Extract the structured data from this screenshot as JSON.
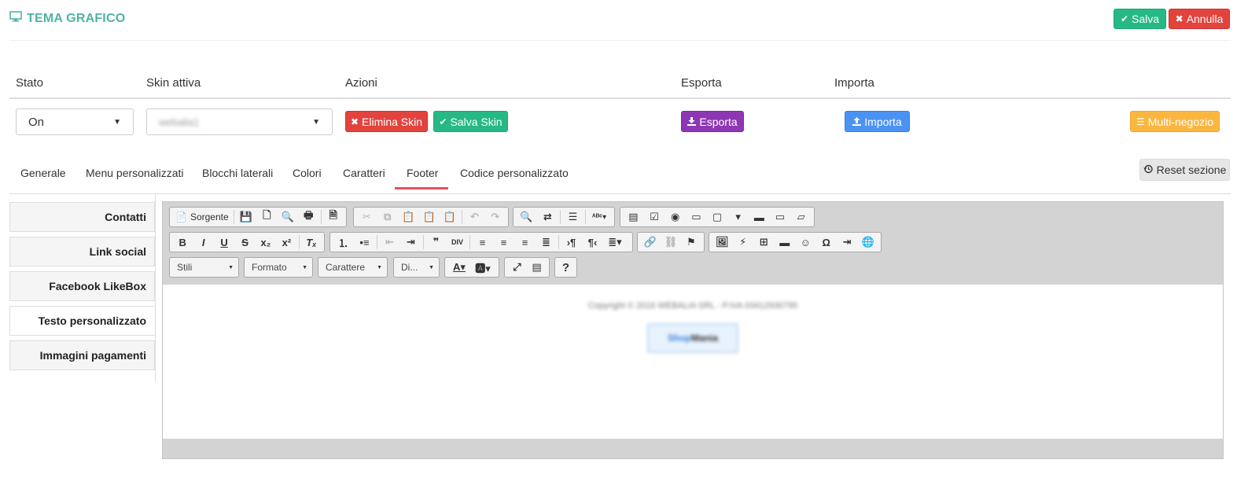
{
  "header": {
    "title": "TEMA GRAFICO",
    "save_label": "Salva",
    "cancel_label": "Annulla"
  },
  "columns": [
    "Stato",
    "Skin attiva",
    "Azioni",
    "Esporta",
    "Importa"
  ],
  "row": {
    "stato_value": "On",
    "skin_value": "webalia1",
    "delete_skin_label": "Elimina Skin",
    "save_skin_label": "Salva Skin",
    "export_label": "Esporta",
    "import_label": "Importa",
    "multistore_label": "Multi-negozio"
  },
  "tabs": [
    "Generale",
    "Menu personalizzati",
    "Blocchi laterali",
    "Colori",
    "Caratteri",
    "Footer",
    "Codice personalizzato"
  ],
  "active_tab": "Footer",
  "reset_label": "Reset sezione",
  "side_items": [
    "Contatti",
    "Link social",
    "Facebook LikeBox",
    "Testo personalizzato",
    "Immagini pagamenti"
  ],
  "active_side_item": "Testo personalizzato",
  "editor": {
    "source_label": "Sorgente",
    "combos": [
      "Stili",
      "Formato",
      "Carattere",
      "Di..."
    ],
    "content_copyright": "Copyright © 2016 WEBALIA SRL - P.IVA 03412930795",
    "logo_part1": "Shop",
    "logo_part2": "Mania"
  },
  "colors": {
    "accent_teal": "#4db4a4",
    "green": "#26b985",
    "red": "#e2433d",
    "purple": "#8e37b5",
    "blue": "#4a93f5",
    "orange": "#fbb640",
    "active_tab_underline": "#e8505b"
  }
}
